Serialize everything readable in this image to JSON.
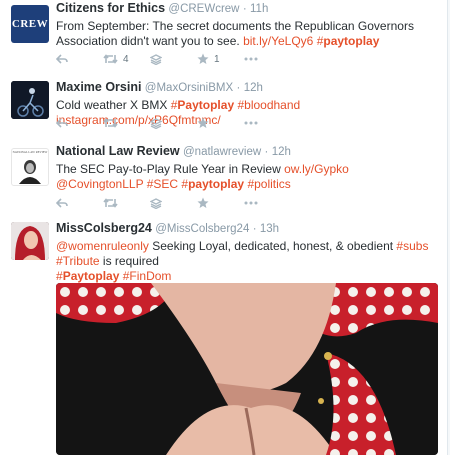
{
  "tweets": [
    {
      "name": "Citizens for Ethics",
      "handle": "@CREWcrew",
      "time": "11h",
      "avatar_text": "CREW",
      "text_before": "From September: The secret documents the Republican Governors Association didn't want you to see.",
      "link": "bit.ly/YeLQy6",
      "tag_hash": "#",
      "tag_word": "paytoplay",
      "retweets": "4",
      "favorites": "1"
    },
    {
      "name": "Maxime Orsini",
      "handle": "@MaxOrsiniBMX",
      "time": "12h",
      "text_before": "Cold weather X BMX",
      "tag1_hash": "#",
      "tag1_word": "Paytoplay",
      "tag2": "#bloodhand",
      "link": "instagram.com/p/xP6Qfmtnmc/"
    },
    {
      "name": "National Law Review",
      "handle": "@natlawreview",
      "time": "12h",
      "avatar_caption": "NATIONAL LAW REVIEW",
      "text_before": "The SEC Pay-to-Play Rule Year in Review",
      "link": "ow.ly/Gypko",
      "mention": "@CovingtonLLP",
      "tag_sec": "#SEC",
      "tag_pay_hash": "#",
      "tag_pay_word": "paytoplay",
      "tag_politics": "#politics"
    },
    {
      "name": "MissColsberg24",
      "handle": "@MissColsberg24",
      "time": "13h",
      "mention": "@womenruleonly",
      "text_mid": "Seeking Loyal, dedicated, honest, & obedient",
      "tag_subs": "#subs",
      "tag_tribute": "#Tribute",
      "text_after": "is required",
      "tag_pay_hash": "#",
      "tag_pay_word": "Paytoplay",
      "tag_findom": "#FinDom"
    }
  ],
  "separators": {
    "dot": "·"
  },
  "icons": [
    "reply-icon",
    "retweet-icon",
    "stack-icon",
    "star-icon",
    "more-icon"
  ],
  "colors": {
    "link": "#e5502b",
    "meta": "#8899a6",
    "icon": "#aab8c2"
  }
}
